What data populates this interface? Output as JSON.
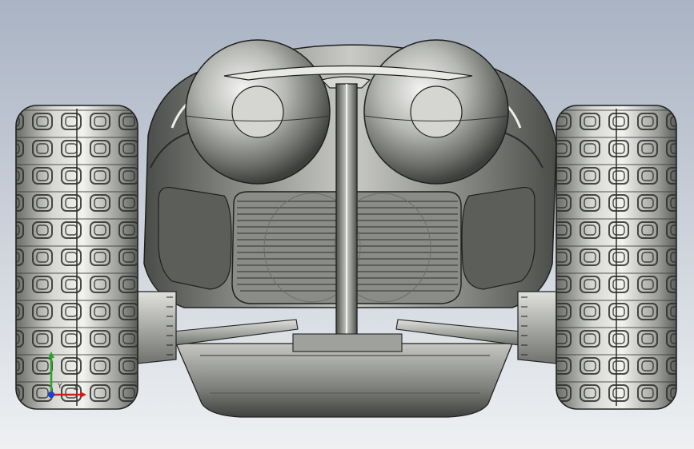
{
  "viewport": {
    "background_top": "#a9b3c3",
    "background_bottom": "#eef0f2",
    "model_color": "#7a7c78"
  },
  "triad": {
    "x_label": "X",
    "y_label": "Y",
    "x_color": "#d21a1a",
    "y_color": "#2aa32a",
    "z_color": "#1a3fd2"
  }
}
